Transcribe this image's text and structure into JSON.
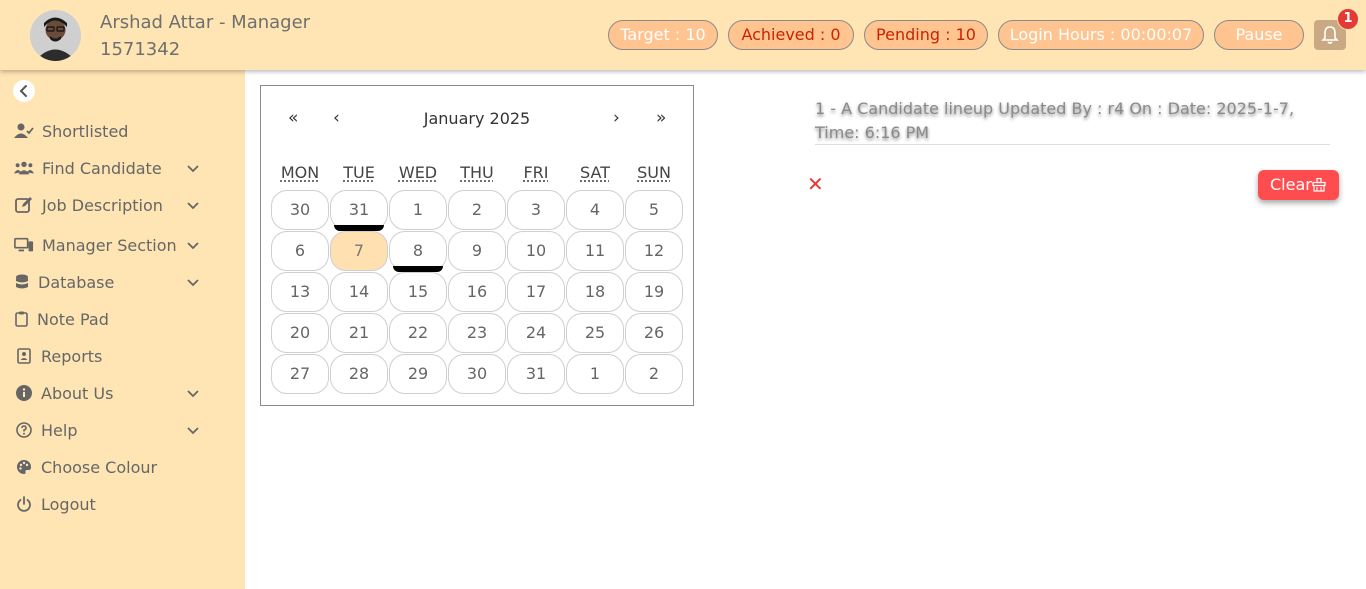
{
  "header": {
    "user_name": "Arshad Attar - Manager",
    "user_id": "1571342",
    "target": "Target : 10",
    "achieved": "Achieved : 0",
    "pending": "Pending : 10",
    "login_hours": "Login Hours : 00:00:07",
    "pause": "Pause",
    "notification_count": "1",
    "icons": [
      "avatar",
      "bell-icon"
    ]
  },
  "sidebar": {
    "items": [
      {
        "label": "Shortlisted",
        "icon": "user-check-icon",
        "expandable": false
      },
      {
        "label": "Find Candidate",
        "icon": "users-icon",
        "expandable": true
      },
      {
        "label": "Job Description",
        "icon": "edit-icon",
        "expandable": true
      },
      {
        "label": "Manager Section",
        "icon": "monitor-icon",
        "expandable": true
      },
      {
        "label": "Database",
        "icon": "database-icon",
        "expandable": true
      },
      {
        "label": "Note Pad",
        "icon": "clipboard-icon",
        "expandable": false
      },
      {
        "label": "Reports",
        "icon": "report-icon",
        "expandable": false
      },
      {
        "label": "About Us",
        "icon": "info-icon",
        "expandable": true
      },
      {
        "label": "Help",
        "icon": "help-icon",
        "expandable": true
      },
      {
        "label": "Choose Colour",
        "icon": "palette-icon",
        "expandable": false
      },
      {
        "label": "Logout",
        "icon": "power-icon",
        "expandable": false
      }
    ]
  },
  "calendar": {
    "title": "January 2025",
    "nav": {
      "prev_year": "«",
      "prev_month": "‹",
      "next_month": "›",
      "next_year": "»"
    },
    "weekdays": [
      "MON",
      "TUE",
      "WED",
      "THU",
      "FRI",
      "SAT",
      "SUN"
    ],
    "weeks": [
      [
        "30",
        "31",
        "1",
        "2",
        "3",
        "4",
        "5"
      ],
      [
        "6",
        "7",
        "8",
        "9",
        "10",
        "11",
        "12"
      ],
      [
        "13",
        "14",
        "15",
        "16",
        "17",
        "18",
        "19"
      ],
      [
        "20",
        "21",
        "22",
        "23",
        "24",
        "25",
        "26"
      ],
      [
        "27",
        "28",
        "29",
        "30",
        "31",
        "1",
        "2"
      ]
    ],
    "selected_day": "7",
    "marked_days": [
      "31",
      "8"
    ]
  },
  "notifications": {
    "message": "1 - A Candidate lineup Updated By : r4 On : Date: 2025-1-7, Time: 6:16 PM",
    "close_symbol": "✕",
    "clear_label": "Clear"
  },
  "colors": {
    "header_bg": "#ffe5b4",
    "pill_bg": "#ffc48f",
    "alert_red": "#ff4d4f"
  }
}
